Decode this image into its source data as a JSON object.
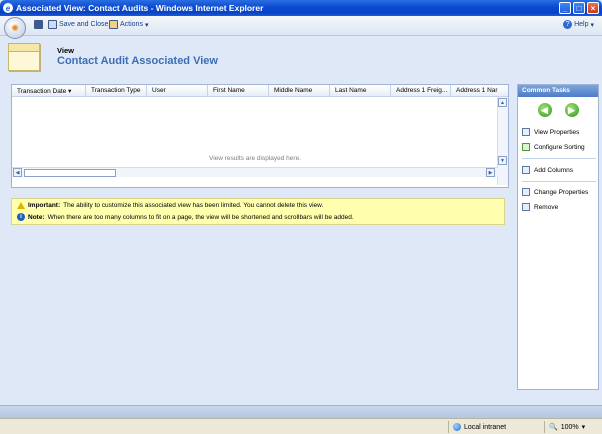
{
  "window": {
    "title": "Associated View: Contact Audits - Windows Internet Explorer"
  },
  "toolbar": {
    "save_close_label": "Save and Close",
    "actions_label": "Actions",
    "help_label": "Help"
  },
  "header": {
    "small_label": "View",
    "title": "Contact Audit Associated View"
  },
  "grid": {
    "columns": [
      "Transaction Date",
      "Transaction Type",
      "User",
      "First Name",
      "Middle Name",
      "Last Name",
      "Address 1 Freig...",
      "Address 1 Nar"
    ],
    "empty_message": "View results are displayed here."
  },
  "notices": {
    "important_label": "Important:",
    "important_text": "The ability to customize this associated view has been limited. You cannot delete this view.",
    "note_label": "Note:",
    "note_text": "When there are too many columns to fit on a page, the view will be shortened and scrollbars will be added."
  },
  "common_tasks": {
    "title": "Common Tasks",
    "items": [
      "View Properties",
      "Configure Sorting",
      "Add Columns",
      "Change Properties",
      "Remove"
    ]
  },
  "statusbar": {
    "zone": "Local intranet",
    "zoom": "100%"
  }
}
